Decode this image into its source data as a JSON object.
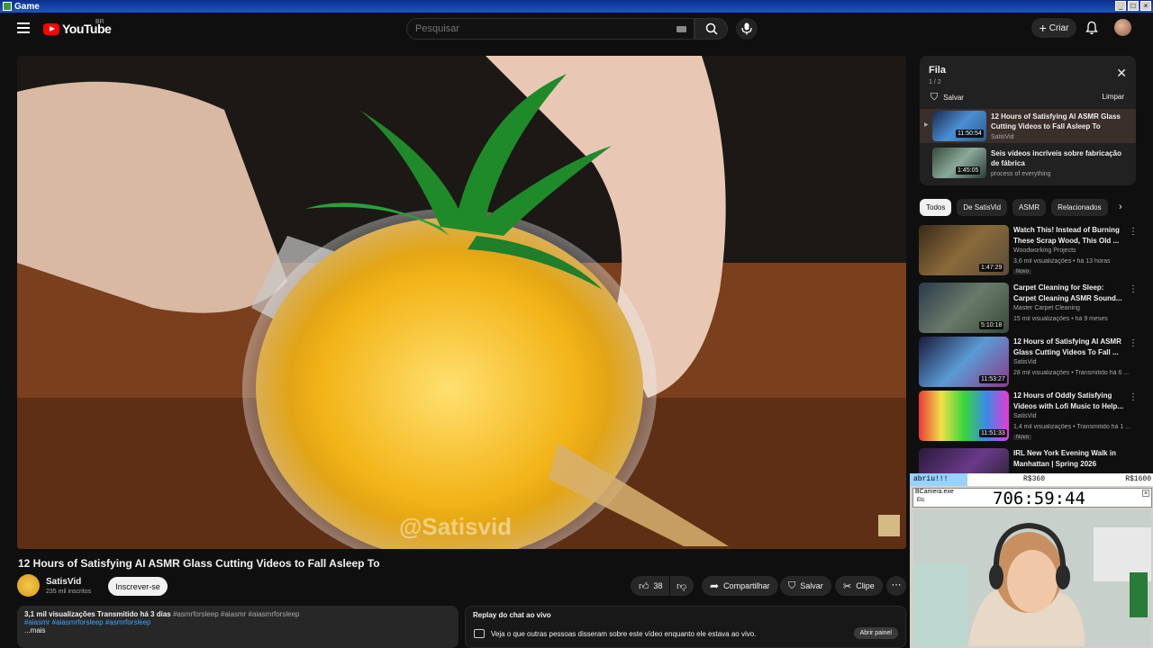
{
  "window": {
    "title": "Game"
  },
  "header": {
    "logo": "YouTube",
    "region": "BR",
    "search_placeholder": "Pesquisar",
    "create_label": "Criar"
  },
  "player": {
    "watermark": "@Satisvid"
  },
  "video": {
    "title": "12 Hours of Satisfying AI ASMR Glass Cutting Videos to Fall Asleep To",
    "channel": "SatisVid",
    "subscribers": "235 mil inscritos",
    "subscribe_label": "Inscrever-se",
    "likes": "38",
    "share_label": "Compartilhar",
    "save_label": "Salvar",
    "clip_label": "Clipe"
  },
  "description": {
    "views": "3,1 mil visualizações  Transmitido há 3 dias",
    "tags1": "#asmrforsleep #aiasmr #aiasmrforsleep",
    "tags2": "#aiasmr #aiasmrforsleep #asmrforsleep",
    "more": "...mais"
  },
  "chat_replay": {
    "title": "Replay do chat ao vivo",
    "text": "Veja o que outras pessoas disseram sobre este vídeo enquanto ele estava ao vivo.",
    "button": "Abrir painel"
  },
  "queue": {
    "title": "Fila",
    "count": "1 / 2",
    "save_label": "Salvar",
    "clear_label": "Limpar",
    "items": [
      {
        "title": "12 Hours of Satisfying AI ASMR Glass Cutting Videos to Fall Asleep To",
        "channel": "SatisVid",
        "duration": "11:50:54"
      },
      {
        "title": "Seis vídeos incríveis sobre fabricação de fábrica",
        "channel": "process of everything",
        "duration": "1:45:05"
      }
    ]
  },
  "chips": [
    "Todos",
    "De SatisVid",
    "ASMR",
    "Relacionados"
  ],
  "recommendations": [
    {
      "title": "Watch This! Instead of Burning These Scrap Wood, This Old ...",
      "channel": "Woodworking Projects",
      "meta": "3,6 mil visualizações • há 13 horas",
      "badge": "Novo",
      "duration": "1:47:29"
    },
    {
      "title": "Carpet Cleaning for Sleep: Carpet Cleaning ASMR Sound...",
      "channel": "Master Carpet Cleaning",
      "meta": "15 mil visualizações • há 9 meses",
      "badge": "",
      "duration": "5:10:18"
    },
    {
      "title": "12 Hours of Satisfying AI ASMR Glass Cutting Videos To Fall ...",
      "channel": "SatisVid",
      "meta": "28 mil visualizações • Transmitido há 6 ...",
      "badge": "",
      "duration": "11:53:27"
    },
    {
      "title": "12 Hours of Oddly Satisfying Videos with Lofi Music to Help...",
      "channel": "SatisVid",
      "meta": "1,4 mil visualizações • Transmitido há 1 ...",
      "badge": "Novo",
      "duration": "11:51:33"
    },
    {
      "title": "IRL New York Evening Walk in Manhattan | Spring 2026",
      "channel": "",
      "meta": "",
      "badge": "",
      "duration": ""
    }
  ],
  "overlay": {
    "seg1": "abriu!!!",
    "seg2": "R$360",
    "seg3": "R$1600",
    "window_name": "BCamera.exe",
    "window_etc": "Etc",
    "timer": "706:59:44"
  },
  "colors": {
    "accent": "#ff0000",
    "link": "#3ea6ff",
    "background": "#0f0f0f"
  }
}
